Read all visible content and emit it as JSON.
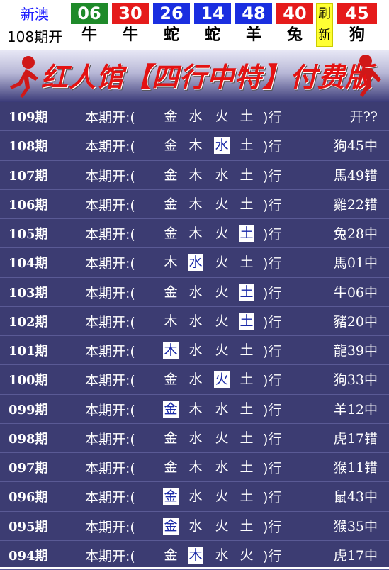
{
  "header": {
    "label_line1": "新澳",
    "label_line2": "108期开",
    "balls": [
      {
        "num": "06",
        "zodiac": "牛",
        "color": "#1f8a2a"
      },
      {
        "num": "30",
        "zodiac": "牛",
        "color": "#e51b1b"
      },
      {
        "num": "26",
        "zodiac": "蛇",
        "color": "#1a2ee0"
      },
      {
        "num": "14",
        "zodiac": "蛇",
        "color": "#1a2ee0"
      },
      {
        "num": "48",
        "zodiac": "羊",
        "color": "#1a2ee0"
      },
      {
        "num": "40",
        "zodiac": "兔",
        "color": "#e51b1b"
      },
      {
        "num": "45",
        "zodiac": "狗",
        "color": "#e51b1b"
      }
    ],
    "refresh_top": "刷",
    "refresh_bottom": "新"
  },
  "banner": {
    "title": "红人馆【四行中特】付费版"
  },
  "rows": [
    {
      "period": "109期",
      "prefix": "本期开:(",
      "elements": [
        "金",
        "水",
        "火",
        "土"
      ],
      "highlight": -1,
      "suffix": ")行",
      "result": "开??"
    },
    {
      "period": "108期",
      "prefix": "本期开:(",
      "elements": [
        "金",
        "木",
        "水",
        "土"
      ],
      "highlight": 2,
      "suffix": ")行",
      "result": "狗45中"
    },
    {
      "period": "107期",
      "prefix": "本期开:(",
      "elements": [
        "金",
        "木",
        "水",
        "土"
      ],
      "highlight": -1,
      "suffix": ")行",
      "result": "馬49错"
    },
    {
      "period": "106期",
      "prefix": "本期开:(",
      "elements": [
        "金",
        "木",
        "火",
        "土"
      ],
      "highlight": -1,
      "suffix": ")行",
      "result": "雞22错"
    },
    {
      "period": "105期",
      "prefix": "本期开:(",
      "elements": [
        "金",
        "木",
        "火",
        "土"
      ],
      "highlight": 3,
      "suffix": ")行",
      "result": "兔28中"
    },
    {
      "period": "104期",
      "prefix": "本期开:(",
      "elements": [
        "木",
        "水",
        "火",
        "土"
      ],
      "highlight": 1,
      "suffix": ")行",
      "result": "馬01中"
    },
    {
      "period": "103期",
      "prefix": "本期开:(",
      "elements": [
        "金",
        "水",
        "火",
        "土"
      ],
      "highlight": 3,
      "suffix": ")行",
      "result": "牛06中"
    },
    {
      "period": "102期",
      "prefix": "本期开:(",
      "elements": [
        "木",
        "水",
        "火",
        "土"
      ],
      "highlight": 3,
      "suffix": ")行",
      "result": "豬20中"
    },
    {
      "period": "101期",
      "prefix": "本期开:(",
      "elements": [
        "木",
        "水",
        "火",
        "土"
      ],
      "highlight": 0,
      "suffix": ")行",
      "result": "龍39中"
    },
    {
      "period": "100期",
      "prefix": "本期开:(",
      "elements": [
        "金",
        "水",
        "火",
        "土"
      ],
      "highlight": 2,
      "suffix": ")行",
      "result": "狗33中"
    },
    {
      "period": "099期",
      "prefix": "本期开:(",
      "elements": [
        "金",
        "木",
        "水",
        "土"
      ],
      "highlight": 0,
      "suffix": ")行",
      "result": "羊12中"
    },
    {
      "period": "098期",
      "prefix": "本期开:(",
      "elements": [
        "金",
        "水",
        "火",
        "土"
      ],
      "highlight": -1,
      "suffix": ")行",
      "result": "虎17错"
    },
    {
      "period": "097期",
      "prefix": "本期开:(",
      "elements": [
        "金",
        "木",
        "水",
        "土"
      ],
      "highlight": -1,
      "suffix": ")行",
      "result": "猴11错"
    },
    {
      "period": "096期",
      "prefix": "本期开:(",
      "elements": [
        "金",
        "水",
        "火",
        "土"
      ],
      "highlight": 0,
      "suffix": ")行",
      "result": "鼠43中"
    },
    {
      "period": "095期",
      "prefix": "本期开:(",
      "elements": [
        "金",
        "水",
        "火",
        "土"
      ],
      "highlight": 0,
      "suffix": ")行",
      "result": "猴35中"
    },
    {
      "period": "094期",
      "prefix": "本期开:(",
      "elements": [
        "金",
        "木",
        "水",
        "火"
      ],
      "highlight": 1,
      "suffix": ")行",
      "result": "虎17中"
    }
  ]
}
